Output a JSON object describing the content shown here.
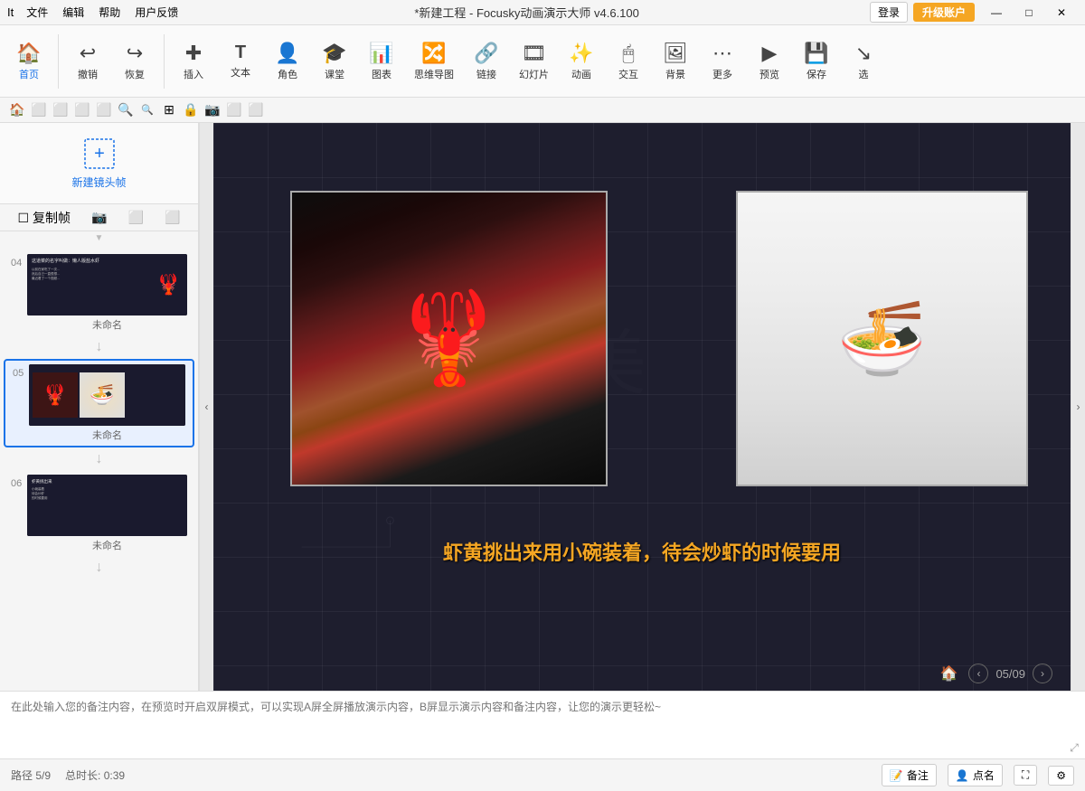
{
  "titlebar": {
    "menu": [
      "文件",
      "编辑",
      "帮助",
      "用户反馈"
    ],
    "logo": "It",
    "title": "*新建工程 - Focusky动画演示大师 v4.6.100",
    "login": "登录",
    "upgrade": "升级账户",
    "win_btns": [
      "—",
      "□",
      "✕"
    ]
  },
  "toolbar": {
    "items": [
      {
        "id": "home",
        "icon": "🏠",
        "label": "首页"
      },
      {
        "id": "undo",
        "icon": "↩",
        "label": "撤销"
      },
      {
        "id": "redo",
        "icon": "↪",
        "label": "恢复"
      },
      {
        "id": "insert",
        "icon": "✚",
        "label": "插入"
      },
      {
        "id": "text",
        "icon": "T",
        "label": "文本"
      },
      {
        "id": "role",
        "icon": "👤",
        "label": "角色"
      },
      {
        "id": "class",
        "icon": "🎓",
        "label": "课堂"
      },
      {
        "id": "chart",
        "icon": "📊",
        "label": "图表"
      },
      {
        "id": "mindmap",
        "icon": "🔗",
        "label": "思维导图"
      },
      {
        "id": "link",
        "icon": "🔗",
        "label": "链接"
      },
      {
        "id": "slide",
        "icon": "🎞",
        "label": "幻灯片"
      },
      {
        "id": "animation",
        "icon": "🎬",
        "label": "动画"
      },
      {
        "id": "interact",
        "icon": "🖱",
        "label": "交互"
      },
      {
        "id": "bg",
        "icon": "🖼",
        "label": "背景"
      },
      {
        "id": "more",
        "icon": "⋯",
        "label": "更多"
      },
      {
        "id": "preview",
        "icon": "👁",
        "label": "预览"
      },
      {
        "id": "save",
        "icon": "💾",
        "label": "保存"
      },
      {
        "id": "select",
        "icon": "↘",
        "label": "选"
      }
    ]
  },
  "toolbar2": {
    "buttons": [
      "🏠",
      "⬜",
      "⬜",
      "⬜",
      "⬜",
      "🔍+",
      "🔍-",
      "⊞",
      "🔒",
      "📷",
      "⬜",
      "⬜"
    ]
  },
  "left_panel": {
    "new_frame": "新建镜头帧",
    "frame_tools": [
      "复制帧",
      "📷",
      "⬜",
      "⬜"
    ],
    "collapse_arrow": "▼",
    "slides": [
      {
        "number": "04",
        "name": "未命名",
        "content": "text_with_lobster"
      },
      {
        "number": "05",
        "name": "未命名",
        "content": "lobster_and_bowl",
        "active": true
      },
      {
        "number": "06",
        "name": "未命名",
        "content": "text_slide"
      }
    ]
  },
  "canvas": {
    "caption": "虾黄挑出来用小碗装着，待会炒虾的时候要用",
    "page_current": "05",
    "page_total": "09",
    "path_label": "路径 5/9",
    "duration": "总时长: 0:39"
  },
  "notes": {
    "placeholder": "在此处输入您的备注内容，在预览时开启双屏模式，可以实现A屏全屏播放演示内容，B屏显示演示内容和备注内容，让您的演示更轻松~"
  },
  "statusbar": {
    "path": "路径 5/9",
    "duration": "总时长: 0:39",
    "notes_btn": "备注",
    "points_btn": "点名"
  },
  "colors": {
    "accent_blue": "#1a73e8",
    "accent_orange": "#f5a623",
    "canvas_bg": "#1e1e2e",
    "text_caption": "#f5a623"
  }
}
